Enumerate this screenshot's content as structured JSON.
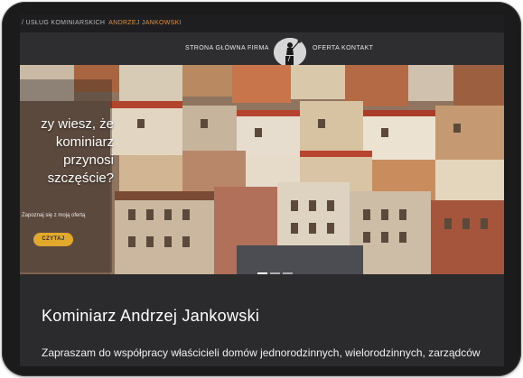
{
  "topbar": {
    "prefix": "/ USŁUG KOMINIARSKICH",
    "owner": "ANDRZEJ JANKOWSKI"
  },
  "nav": {
    "items": [
      {
        "label": "STRONA GŁÓWNA"
      },
      {
        "label": "FIRMA"
      },
      {
        "label": "OFERTA"
      },
      {
        "label": "KONTAKT"
      }
    ]
  },
  "hero": {
    "title": "zy wiesz, że\nkominiarz\nprzynosi\nszczęście?",
    "subtitle": "Zapoznaj się z moją ofertą",
    "cta_label": "CZYTAJ"
  },
  "main": {
    "heading": "Kominiarz Andrzej Jankowski",
    "intro": "Zapraszam do współpracy właścicieli domów jednorodzinnych, wielorodzinnych, zarządców"
  },
  "colors": {
    "accent": "#e3a92c",
    "owner_text": "#e0913b",
    "background": "#2b2b2d"
  }
}
